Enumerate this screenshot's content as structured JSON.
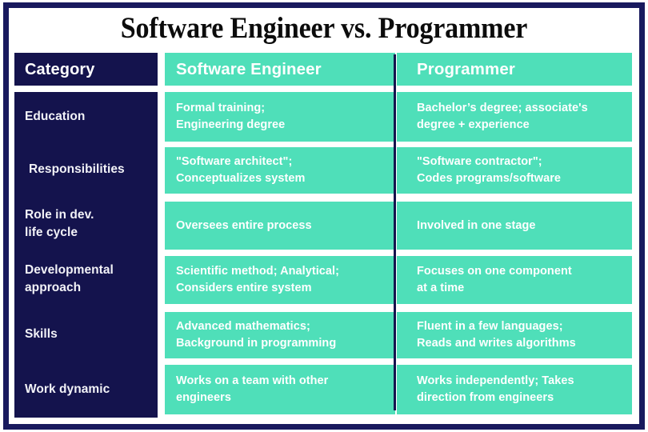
{
  "title": "Software Engineer vs. Programmer",
  "colors": {
    "navy": "#14134d",
    "frame_navy": "#191a5e",
    "teal": "#4fdfb9",
    "text_light": "#ffffff",
    "title_black": "#0c0c0c",
    "background": "#ffffff"
  },
  "table": {
    "headers": {
      "category": "Category",
      "software_engineer": "Software Engineer",
      "programmer": "Programmer"
    },
    "rows": [
      {
        "category": "Education",
        "software_engineer": "Formal training;\nEngineering degree",
        "programmer": "Bachelor’s degree; associate's\ndegree + experience"
      },
      {
        "category": "Responsibilities",
        "software_engineer": "\"Software architect\";\nConceptualizes system",
        "programmer": "\"Software contractor\";\nCodes programs/software"
      },
      {
        "category": "Role in dev.\nlife cycle",
        "software_engineer": "Oversees entire process",
        "programmer": "Involved in one stage"
      },
      {
        "category": "Developmental\napproach",
        "software_engineer": "Scientific method; Analytical;\nConsiders entire system",
        "programmer": "Focuses on one component\nat a time"
      },
      {
        "category": "Skills",
        "software_engineer": "Advanced mathematics;\nBackground in programming",
        "programmer": "Fluent in a few languages;\nReads and writes algorithms"
      },
      {
        "category": "Work dynamic",
        "software_engineer": "Works on a team with other\nengineers",
        "programmer": "Works independently; Takes\ndirection from engineers"
      }
    ]
  }
}
